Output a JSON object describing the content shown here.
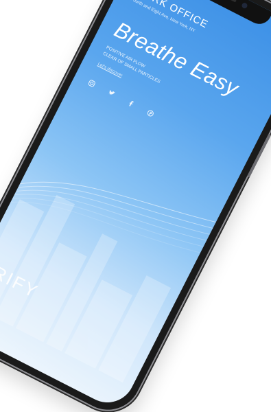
{
  "office": {
    "title": "WORK OFFICE",
    "address": "Fourth and Eight Ave, New York, NY"
  },
  "hero": {
    "headline": "Breathe Easy",
    "tagline_line1": "POSITIVE AIR FLOW",
    "tagline_line2": "CLEAR OF SMALL PARTICLES",
    "link": "Let's discover"
  },
  "socials": [
    "instagram-icon",
    "twitter-icon",
    "facebook-icon",
    "pinterest-icon"
  ],
  "brand": "PURIFY",
  "colors": {
    "screen_top": "#3b8fe6",
    "screen_bottom": "#eef6fd",
    "text": "#ffffff",
    "frame": "#1a1a1a"
  }
}
